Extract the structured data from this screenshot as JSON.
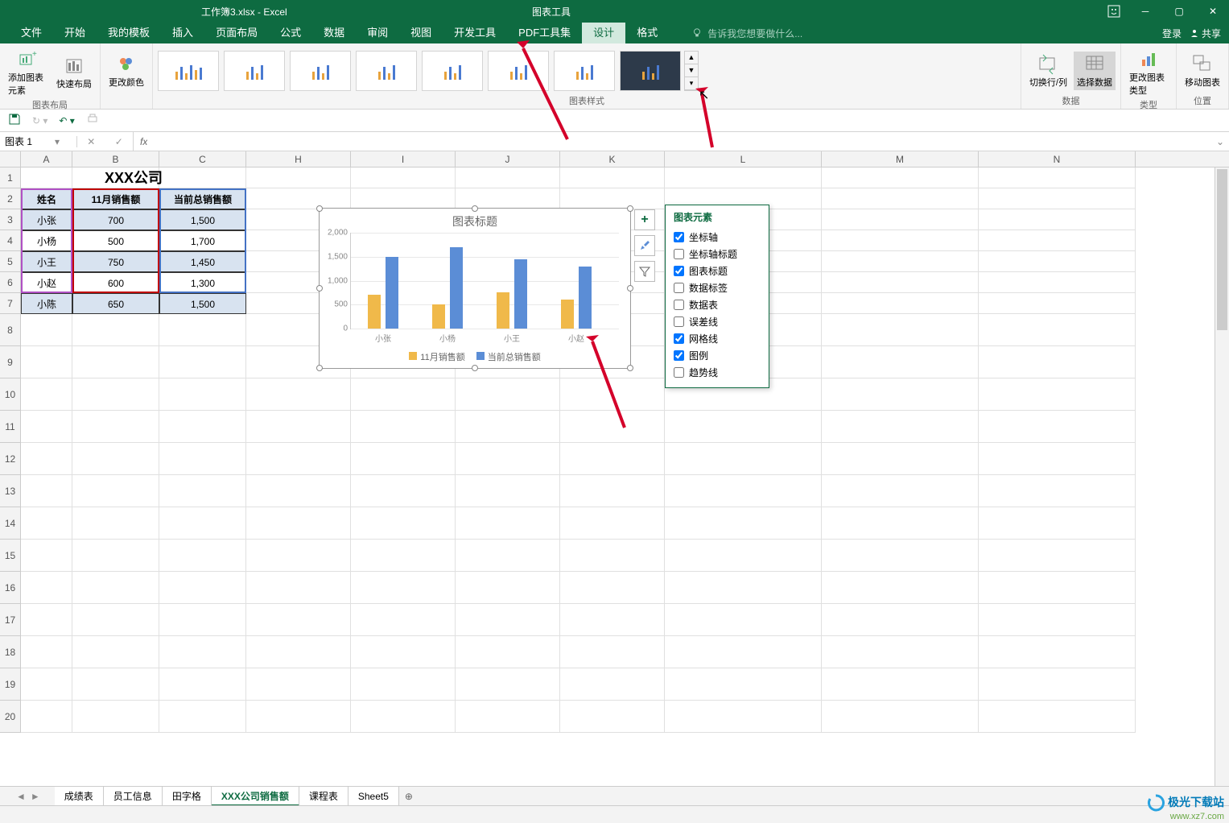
{
  "title_bar": {
    "doc_title": "工作簿3.xlsx - Excel",
    "tool_context": "图表工具",
    "login": "登录",
    "share": "共享"
  },
  "tabs": {
    "file": "文件",
    "home": "开始",
    "my_templates": "我的模板",
    "insert": "插入",
    "page_layout": "页面布局",
    "formulas": "公式",
    "data": "数据",
    "review": "审阅",
    "view": "视图",
    "dev": "开发工具",
    "pdf": "PDF工具集",
    "design": "设计",
    "format": "格式",
    "tell_me": "告诉我您想要做什么..."
  },
  "ribbon": {
    "group_layout": "图表布局",
    "btn_add_element": "添加图表元素",
    "btn_quick_layout": "快速布局",
    "btn_change_colors": "更改颜色",
    "group_styles": "图表样式",
    "group_data": "数据",
    "btn_switch_rc": "切换行/列",
    "btn_select_data": "选择数据",
    "group_type": "类型",
    "btn_change_type": "更改图表类型",
    "group_location": "位置",
    "btn_move_chart": "移动图表"
  },
  "name_box": "图表 1",
  "formula": "",
  "columns": [
    "A",
    "B",
    "C",
    "H",
    "I",
    "J",
    "K",
    "L",
    "M",
    "N"
  ],
  "rows": [
    "1",
    "2",
    "3",
    "4",
    "5",
    "6",
    "7",
    "8",
    "9",
    "10",
    "11",
    "12",
    "13",
    "14",
    "15",
    "16",
    "17",
    "18",
    "19",
    "20"
  ],
  "table": {
    "company_title": "XXX公司",
    "headers": {
      "name": "姓名",
      "nov_sales": "11月销售额",
      "total_sales": "当前总销售额"
    },
    "rows": [
      {
        "name": "小张",
        "nov": "700",
        "total": "1,500"
      },
      {
        "name": "小杨",
        "nov": "500",
        "total": "1,700"
      },
      {
        "name": "小王",
        "nov": "750",
        "total": "1,450"
      },
      {
        "name": "小赵",
        "nov": "600",
        "total": "1,300"
      },
      {
        "name": "小陈",
        "nov": "650",
        "total": "1,500"
      }
    ]
  },
  "chart_data": {
    "type": "bar",
    "title": "图表标题",
    "categories": [
      "小张",
      "小杨",
      "小王",
      "小赵"
    ],
    "series": [
      {
        "name": "11月销售额",
        "values": [
          700,
          500,
          750,
          600
        ],
        "color": "#f0b94a"
      },
      {
        "name": "当前总销售额",
        "values": [
          1500,
          1700,
          1450,
          1300
        ],
        "color": "#5b8dd6"
      }
    ],
    "ylim": [
      0,
      2000
    ],
    "yticks": [
      0,
      500,
      1000,
      1500,
      2000
    ],
    "xlabel": "",
    "ylabel": ""
  },
  "side_buttons": {
    "plus": "+",
    "brush": "✎",
    "filter": "▾"
  },
  "elements_popup": {
    "title": "图表元素",
    "items": [
      {
        "label": "坐标轴",
        "checked": true
      },
      {
        "label": "坐标轴标题",
        "checked": false
      },
      {
        "label": "图表标题",
        "checked": true
      },
      {
        "label": "数据标签",
        "checked": false
      },
      {
        "label": "数据表",
        "checked": false
      },
      {
        "label": "误差线",
        "checked": false
      },
      {
        "label": "网格线",
        "checked": true
      },
      {
        "label": "图例",
        "checked": true
      },
      {
        "label": "趋势线",
        "checked": false
      }
    ]
  },
  "sheets": {
    "tabs": [
      "成绩表",
      "员工信息",
      "田字格",
      "XXX公司销售额",
      "课程表",
      "Sheet5"
    ],
    "active": 3
  },
  "watermark": {
    "cn": "极光下载站",
    "url": "www.xz7.com"
  }
}
